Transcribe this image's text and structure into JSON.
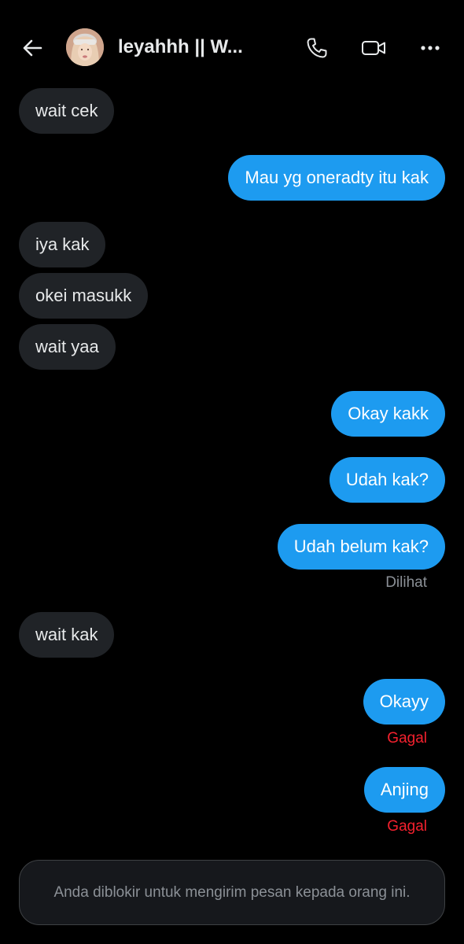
{
  "header": {
    "contact_name": "leyahhh || W...",
    "icons": {
      "back": "arrow-left-icon",
      "phone": "phone-icon",
      "video": "video-camera-icon",
      "more": "more-horizontal-icon"
    }
  },
  "messages": [
    {
      "side": "received",
      "text": "wait cek"
    },
    {
      "side": "sent",
      "text": "Mau yg oneradty itu kak"
    },
    {
      "side": "received",
      "text": "iya kak"
    },
    {
      "side": "received",
      "text": "okei masukk"
    },
    {
      "side": "received",
      "text": "wait yaa"
    },
    {
      "side": "sent",
      "text": "Okay kakk"
    },
    {
      "side": "sent",
      "text": "Udah kak?"
    },
    {
      "side": "sent",
      "text": "Udah belum kak?",
      "status": "Dilihat"
    },
    {
      "side": "received",
      "text": "wait kak"
    },
    {
      "side": "sent",
      "text": "Okayy",
      "status": "Gagal"
    },
    {
      "side": "sent",
      "text": "Anjing",
      "status": "Gagal"
    }
  ],
  "composer": {
    "blocked_notice": "Anda diblokir untuk mengirim pesan kepada orang ini."
  },
  "colors": {
    "background": "#000000",
    "sent_bubble": "#1d9bf0",
    "received_bubble": "#202327",
    "failed_status": "#f4212e",
    "seen_status": "#8b9096"
  }
}
